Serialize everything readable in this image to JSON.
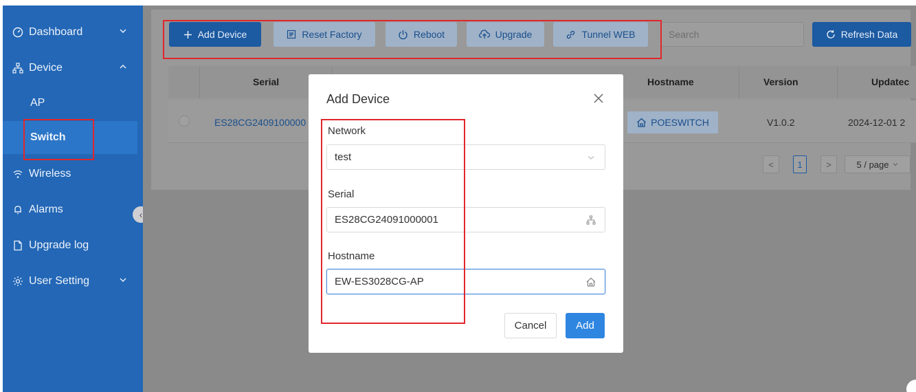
{
  "sidebar": {
    "items": [
      {
        "label": "Dashboard",
        "icon": "dashboard-icon"
      },
      {
        "label": "Device",
        "icon": "device-tree-icon"
      },
      {
        "label": "Wireless",
        "icon": "wifi-icon"
      },
      {
        "label": "Alarms",
        "icon": "bell-icon"
      },
      {
        "label": "Upgrade log",
        "icon": "file-icon"
      },
      {
        "label": "User Setting",
        "icon": "gear-icon"
      }
    ],
    "sub_items": [
      {
        "label": "AP"
      },
      {
        "label": "Switch",
        "selected": true
      }
    ]
  },
  "toolbar": {
    "add_device": "Add Device",
    "reset_factory": "Reset Factory",
    "reboot": "Reboot",
    "upgrade": "Upgrade",
    "tunnel_web": "Tunnel WEB",
    "search_placeholder": "Search",
    "refresh": "Refresh Data"
  },
  "table": {
    "headers": [
      "Serial",
      "Hostname",
      "Version",
      "Updatec"
    ],
    "row": {
      "serial": "ES28CG2409100000",
      "hostname": "POESWITCH",
      "version": "V1.0.2",
      "updated": "2024-12-01 2"
    }
  },
  "pagination": {
    "prev": "<",
    "current": "1",
    "next": ">",
    "page_size": "5 / page"
  },
  "modal": {
    "title": "Add Device",
    "close": "×",
    "network_label": "Network",
    "network_value": "test",
    "serial_label": "Serial",
    "serial_value": "ES28CG24091000001",
    "hostname_label": "Hostname",
    "hostname_value": "EW-ES3028CG-AP",
    "cancel": "Cancel",
    "add": "Add"
  },
  "colors": {
    "sidebar_bg": "#2367b6",
    "primary": "#2f86e0",
    "highlight_border": "#e1262b"
  }
}
